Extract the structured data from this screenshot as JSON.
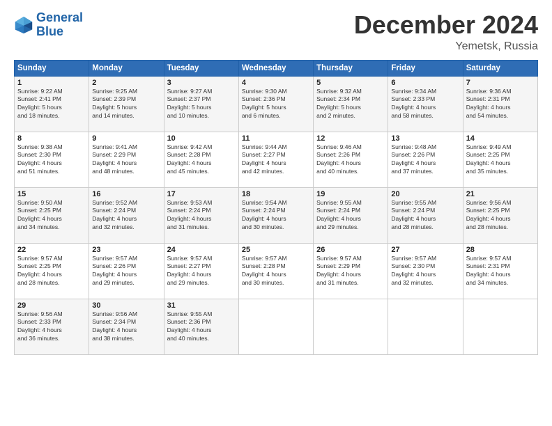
{
  "logo": {
    "line1": "General",
    "line2": "Blue"
  },
  "title": "December 2024",
  "subtitle": "Yemetsk, Russia",
  "days_header": [
    "Sunday",
    "Monday",
    "Tuesday",
    "Wednesday",
    "Thursday",
    "Friday",
    "Saturday"
  ],
  "weeks": [
    [
      {
        "day": "1",
        "info": "Sunrise: 9:22 AM\nSunset: 2:41 PM\nDaylight: 5 hours\nand 18 minutes."
      },
      {
        "day": "2",
        "info": "Sunrise: 9:25 AM\nSunset: 2:39 PM\nDaylight: 5 hours\nand 14 minutes."
      },
      {
        "day": "3",
        "info": "Sunrise: 9:27 AM\nSunset: 2:37 PM\nDaylight: 5 hours\nand 10 minutes."
      },
      {
        "day": "4",
        "info": "Sunrise: 9:30 AM\nSunset: 2:36 PM\nDaylight: 5 hours\nand 6 minutes."
      },
      {
        "day": "5",
        "info": "Sunrise: 9:32 AM\nSunset: 2:34 PM\nDaylight: 5 hours\nand 2 minutes."
      },
      {
        "day": "6",
        "info": "Sunrise: 9:34 AM\nSunset: 2:33 PM\nDaylight: 4 hours\nand 58 minutes."
      },
      {
        "day": "7",
        "info": "Sunrise: 9:36 AM\nSunset: 2:31 PM\nDaylight: 4 hours\nand 54 minutes."
      }
    ],
    [
      {
        "day": "8",
        "info": "Sunrise: 9:38 AM\nSunset: 2:30 PM\nDaylight: 4 hours\nand 51 minutes."
      },
      {
        "day": "9",
        "info": "Sunrise: 9:41 AM\nSunset: 2:29 PM\nDaylight: 4 hours\nand 48 minutes."
      },
      {
        "day": "10",
        "info": "Sunrise: 9:42 AM\nSunset: 2:28 PM\nDaylight: 4 hours\nand 45 minutes."
      },
      {
        "day": "11",
        "info": "Sunrise: 9:44 AM\nSunset: 2:27 PM\nDaylight: 4 hours\nand 42 minutes."
      },
      {
        "day": "12",
        "info": "Sunrise: 9:46 AM\nSunset: 2:26 PM\nDaylight: 4 hours\nand 40 minutes."
      },
      {
        "day": "13",
        "info": "Sunrise: 9:48 AM\nSunset: 2:26 PM\nDaylight: 4 hours\nand 37 minutes."
      },
      {
        "day": "14",
        "info": "Sunrise: 9:49 AM\nSunset: 2:25 PM\nDaylight: 4 hours\nand 35 minutes."
      }
    ],
    [
      {
        "day": "15",
        "info": "Sunrise: 9:50 AM\nSunset: 2:25 PM\nDaylight: 4 hours\nand 34 minutes."
      },
      {
        "day": "16",
        "info": "Sunrise: 9:52 AM\nSunset: 2:24 PM\nDaylight: 4 hours\nand 32 minutes."
      },
      {
        "day": "17",
        "info": "Sunrise: 9:53 AM\nSunset: 2:24 PM\nDaylight: 4 hours\nand 31 minutes."
      },
      {
        "day": "18",
        "info": "Sunrise: 9:54 AM\nSunset: 2:24 PM\nDaylight: 4 hours\nand 30 minutes."
      },
      {
        "day": "19",
        "info": "Sunrise: 9:55 AM\nSunset: 2:24 PM\nDaylight: 4 hours\nand 29 minutes."
      },
      {
        "day": "20",
        "info": "Sunrise: 9:55 AM\nSunset: 2:24 PM\nDaylight: 4 hours\nand 28 minutes."
      },
      {
        "day": "21",
        "info": "Sunrise: 9:56 AM\nSunset: 2:25 PM\nDaylight: 4 hours\nand 28 minutes."
      }
    ],
    [
      {
        "day": "22",
        "info": "Sunrise: 9:57 AM\nSunset: 2:25 PM\nDaylight: 4 hours\nand 28 minutes."
      },
      {
        "day": "23",
        "info": "Sunrise: 9:57 AM\nSunset: 2:26 PM\nDaylight: 4 hours\nand 29 minutes."
      },
      {
        "day": "24",
        "info": "Sunrise: 9:57 AM\nSunset: 2:27 PM\nDaylight: 4 hours\nand 29 minutes."
      },
      {
        "day": "25",
        "info": "Sunrise: 9:57 AM\nSunset: 2:28 PM\nDaylight: 4 hours\nand 30 minutes."
      },
      {
        "day": "26",
        "info": "Sunrise: 9:57 AM\nSunset: 2:29 PM\nDaylight: 4 hours\nand 31 minutes."
      },
      {
        "day": "27",
        "info": "Sunrise: 9:57 AM\nSunset: 2:30 PM\nDaylight: 4 hours\nand 32 minutes."
      },
      {
        "day": "28",
        "info": "Sunrise: 9:57 AM\nSunset: 2:31 PM\nDaylight: 4 hours\nand 34 minutes."
      }
    ],
    [
      {
        "day": "29",
        "info": "Sunrise: 9:56 AM\nSunset: 2:33 PM\nDaylight: 4 hours\nand 36 minutes."
      },
      {
        "day": "30",
        "info": "Sunrise: 9:56 AM\nSunset: 2:34 PM\nDaylight: 4 hours\nand 38 minutes."
      },
      {
        "day": "31",
        "info": "Sunrise: 9:55 AM\nSunset: 2:36 PM\nDaylight: 4 hours\nand 40 minutes."
      },
      {
        "day": "",
        "info": ""
      },
      {
        "day": "",
        "info": ""
      },
      {
        "day": "",
        "info": ""
      },
      {
        "day": "",
        "info": ""
      }
    ]
  ]
}
